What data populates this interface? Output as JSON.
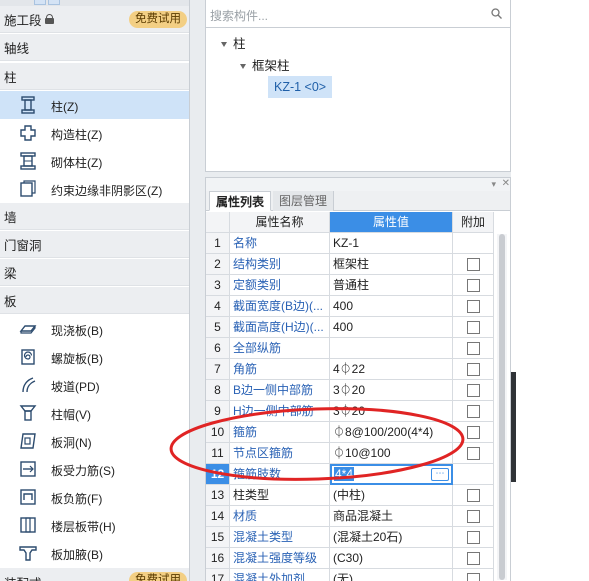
{
  "sidebar": {
    "header": {
      "label": "施工段",
      "badge": "免费试用"
    },
    "categories": [
      "轴线",
      "柱",
      "墙",
      "门窗洞",
      "梁",
      "板"
    ],
    "column_items": [
      {
        "label": "柱(Z)",
        "icon": "column-icon"
      },
      {
        "label": "构造柱(Z)",
        "icon": "constructional-column-icon"
      },
      {
        "label": "砌体柱(Z)",
        "icon": "masonry-column-icon"
      },
      {
        "label": "约束边缘非阴影区(Z)",
        "icon": "boundary-zone-icon"
      }
    ],
    "slab_items": [
      {
        "label": "现浇板(B)",
        "icon": "cast-slab-icon"
      },
      {
        "label": "螺旋板(B)",
        "icon": "spiral-slab-icon"
      },
      {
        "label": "坡道(PD)",
        "icon": "ramp-icon"
      },
      {
        "label": "柱帽(V)",
        "icon": "column-cap-icon"
      },
      {
        "label": "板洞(N)",
        "icon": "slab-hole-icon"
      },
      {
        "label": "板受力筋(S)",
        "icon": "slab-main-rebar-icon"
      },
      {
        "label": "板负筋(F)",
        "icon": "slab-negative-rebar-icon"
      },
      {
        "label": "楼层板带(H)",
        "icon": "floor-strip-icon"
      },
      {
        "label": "板加腋(B)",
        "icon": "slab-haunch-icon"
      }
    ],
    "footer": {
      "label": "装配式",
      "badge": "免费试用"
    }
  },
  "component_tree": {
    "search_placeholder": "搜索构件...",
    "root": "柱",
    "child": "框架柱",
    "selected": "KZ-1 <0>"
  },
  "properties": {
    "tabs": [
      "属性列表",
      "图层管理"
    ],
    "columns": [
      "属性名称",
      "属性值",
      "附加"
    ],
    "rows": [
      {
        "num": "1",
        "name": "名称",
        "value": "KZ-1",
        "link": true,
        "checkbox": false
      },
      {
        "num": "2",
        "name": "结构类别",
        "value": "框架柱",
        "link": true,
        "checkbox": true
      },
      {
        "num": "3",
        "name": "定额类别",
        "value": "普通柱",
        "link": true,
        "checkbox": true
      },
      {
        "num": "4",
        "name": "截面宽度(B边)(...",
        "value": "400",
        "link": true,
        "checkbox": true
      },
      {
        "num": "5",
        "name": "截面高度(H边)(...",
        "value": "400",
        "link": true,
        "checkbox": true
      },
      {
        "num": "6",
        "name": "全部纵筋",
        "value": "",
        "link": true,
        "checkbox": true
      },
      {
        "num": "7",
        "name": "角筋",
        "value": "4⏀22",
        "link": true,
        "checkbox": true
      },
      {
        "num": "8",
        "name": "B边一侧中部筋",
        "value": "3⏀20",
        "link": true,
        "checkbox": true
      },
      {
        "num": "9",
        "name": "H边一侧中部筋",
        "value": "3⏀20",
        "link": true,
        "checkbox": true
      },
      {
        "num": "10",
        "name": "箍筋",
        "value": "⏀8@100/200(4*4)",
        "link": true,
        "checkbox": true
      },
      {
        "num": "11",
        "name": "节点区箍筋",
        "value": "⏀10@100",
        "link": true,
        "checkbox": true
      },
      {
        "num": "12",
        "name": "箍筋肢数",
        "value": "4*4",
        "link": true,
        "checkbox": false
      },
      {
        "num": "13",
        "name": "柱类型",
        "value": "(中柱)",
        "link": false,
        "checkbox": true
      },
      {
        "num": "14",
        "name": "材质",
        "value": "商品混凝土",
        "link": true,
        "checkbox": true
      },
      {
        "num": "15",
        "name": "混凝土类型",
        "value": "(混凝土20石)",
        "link": true,
        "checkbox": true
      },
      {
        "num": "16",
        "name": "混凝土强度等级",
        "value": "(C30)",
        "link": true,
        "checkbox": true
      },
      {
        "num": "17",
        "name": "混凝土外加剂",
        "value": "(无)",
        "link": true,
        "checkbox": true
      }
    ],
    "current_row": "12",
    "ellipsis": "⋯"
  },
  "colors": {
    "accent": "#3b8ee6",
    "selection": "#cfe3f8",
    "link": "#2a62b5",
    "badge": "#f3cf84",
    "annotation": "#e02424"
  }
}
